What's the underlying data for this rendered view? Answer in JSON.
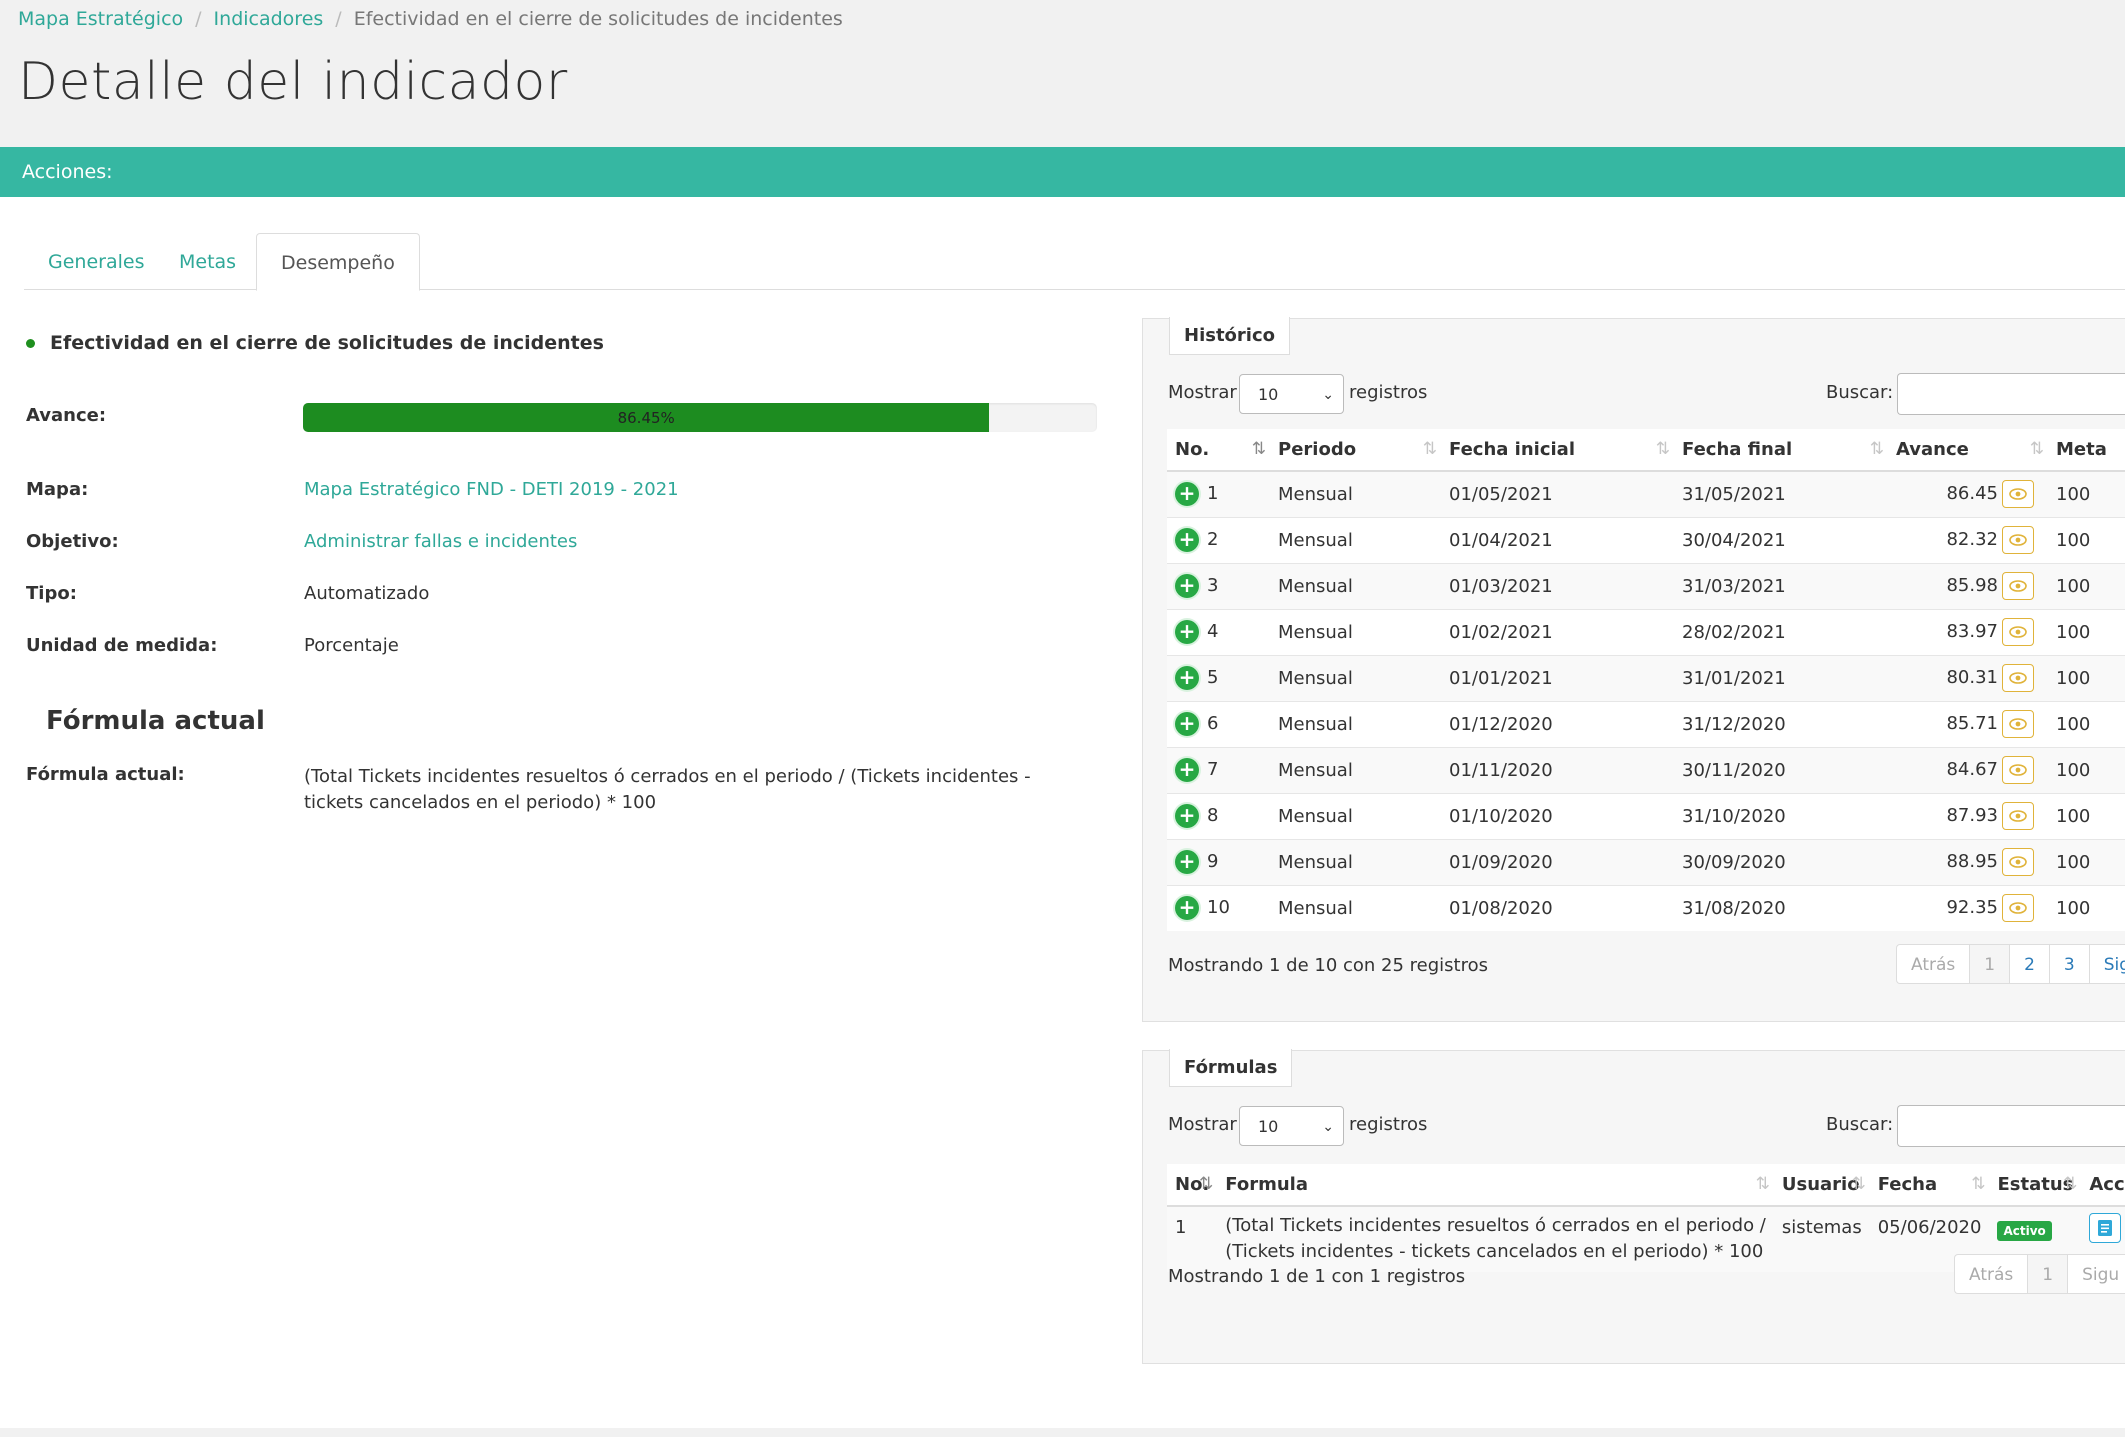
{
  "breadcrumb": {
    "items": [
      "Mapa Estratégico",
      "Indicadores"
    ],
    "current": "Efectividad en el cierre de solicitudes de incidentes",
    "separator": "/"
  },
  "page_title": "Detalle del indicador",
  "actions_label": "Acciones:",
  "tabs": [
    {
      "label": "Generales",
      "active": false
    },
    {
      "label": "Metas",
      "active": false
    },
    {
      "label": "Desempeño",
      "active": true
    }
  ],
  "indicator": {
    "title": "Efectividad en el cierre de solicitudes de incidentes",
    "progress_label": "Avance:",
    "progress_text": "86.45%",
    "progress_value": 86.45,
    "fields": [
      {
        "label": "Mapa:",
        "value": "Mapa Estratégico FND - DETI 2019 - 2021",
        "link": true
      },
      {
        "label": "Objetivo:",
        "value": "Administrar fallas e incidentes",
        "link": true
      },
      {
        "label": "Tipo:",
        "value": "Automatizado",
        "link": false
      },
      {
        "label": "Unidad de medida:",
        "value": "Porcentaje",
        "link": false
      }
    ],
    "formula_heading": "Fórmula actual",
    "formula_label": "Fórmula actual:",
    "formula_text": "(Total Tickets incidentes resueltos ó cerrados en el periodo / (Tickets incidentes - tickets cancelados en el periodo) * 100"
  },
  "historico": {
    "legend": "Histórico",
    "show_label": "Mostrar",
    "page_size": "10",
    "records_label": "registros",
    "search_label": "Buscar:",
    "columns": [
      "No.",
      "Periodo",
      "Fecha inicial",
      "Fecha final",
      "Avance",
      "Meta"
    ],
    "rows": [
      {
        "no": "1",
        "periodo": "Mensual",
        "inicio": "01/05/2021",
        "fin": "31/05/2021",
        "avance": "86.45",
        "meta": "100"
      },
      {
        "no": "2",
        "periodo": "Mensual",
        "inicio": "01/04/2021",
        "fin": "30/04/2021",
        "avance": "82.32",
        "meta": "100"
      },
      {
        "no": "3",
        "periodo": "Mensual",
        "inicio": "01/03/2021",
        "fin": "31/03/2021",
        "avance": "85.98",
        "meta": "100"
      },
      {
        "no": "4",
        "periodo": "Mensual",
        "inicio": "01/02/2021",
        "fin": "28/02/2021",
        "avance": "83.97",
        "meta": "100"
      },
      {
        "no": "5",
        "periodo": "Mensual",
        "inicio": "01/01/2021",
        "fin": "31/01/2021",
        "avance": "80.31",
        "meta": "100"
      },
      {
        "no": "6",
        "periodo": "Mensual",
        "inicio": "01/12/2020",
        "fin": "31/12/2020",
        "avance": "85.71",
        "meta": "100"
      },
      {
        "no": "7",
        "periodo": "Mensual",
        "inicio": "01/11/2020",
        "fin": "30/11/2020",
        "avance": "84.67",
        "meta": "100"
      },
      {
        "no": "8",
        "periodo": "Mensual",
        "inicio": "01/10/2020",
        "fin": "31/10/2020",
        "avance": "87.93",
        "meta": "100"
      },
      {
        "no": "9",
        "periodo": "Mensual",
        "inicio": "01/09/2020",
        "fin": "30/09/2020",
        "avance": "88.95",
        "meta": "100"
      },
      {
        "no": "10",
        "periodo": "Mensual",
        "inicio": "01/08/2020",
        "fin": "31/08/2020",
        "avance": "92.35",
        "meta": "100"
      }
    ],
    "info": "Mostrando 1 de 10 con 25 registros",
    "pager": [
      "Atrás",
      "1",
      "2",
      "3",
      "Sigu"
    ]
  },
  "formulas": {
    "legend": "Fórmulas",
    "show_label": "Mostrar",
    "page_size": "10",
    "records_label": "registros",
    "search_label": "Buscar:",
    "columns": [
      "No.",
      "Formula",
      "Usuario",
      "Fecha",
      "Estatus",
      "Accio"
    ],
    "rows": [
      {
        "no": "1",
        "formula_line1": "(Total Tickets incidentes resueltos ó cerrados en el periodo /",
        "formula_line2": "(Tickets incidentes - tickets cancelados en el periodo) * 100",
        "usuario": "sistemas",
        "fecha": "05/06/2020",
        "estatus": "Activo"
      }
    ],
    "info": "Mostrando 1 de 1 con 1 registros",
    "pager": [
      "Atrás",
      "1",
      "Sigu"
    ]
  },
  "colors": {
    "accent": "#36b7a2",
    "link": "#2fa898",
    "progress": "#1d8c20",
    "status_active": "#28a745",
    "eye_button": "#e0b33a"
  }
}
